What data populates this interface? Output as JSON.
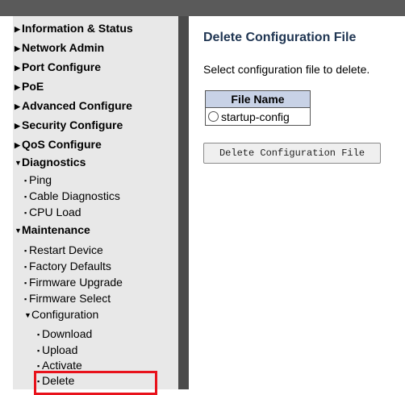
{
  "sidebar": {
    "top_items": [
      {
        "label": "Information & Status",
        "caret": "▶"
      },
      {
        "label": "Network Admin",
        "caret": "▶"
      },
      {
        "label": "Port Configure",
        "caret": "▶"
      },
      {
        "label": "PoE",
        "caret": "▶"
      },
      {
        "label": "Advanced Configure",
        "caret": "▶"
      },
      {
        "label": "Security Configure",
        "caret": "▶"
      },
      {
        "label": "QoS Configure",
        "caret": "▶"
      },
      {
        "label": "Diagnostics",
        "caret": "▼"
      },
      {
        "label": "Maintenance",
        "caret": "▼"
      }
    ],
    "diagnostics_items": [
      "Ping",
      "Cable Diagnostics",
      "CPU Load"
    ],
    "maintenance_items": [
      "Restart Device",
      "Factory Defaults",
      "Firmware Upgrade",
      "Firmware Select"
    ],
    "configuration": {
      "label": "Configuration",
      "caret": "▼",
      "items": [
        "Download",
        "Upload",
        "Activate",
        "Delete"
      ]
    },
    "bullet": "▪",
    "highlight_color": "#e8121b"
  },
  "main": {
    "title": "Delete Configuration File",
    "instructions": "Select configuration file to delete.",
    "table": {
      "header": "File Name",
      "rows": [
        {
          "name": "startup-config",
          "selected": false
        }
      ]
    },
    "delete_button": "Delete Configuration File"
  },
  "colors": {
    "topbar": "#5a5a5a",
    "sidebar_bg": "#e8e8e8",
    "divider": "#4a4a4a",
    "title": "#1f3552",
    "table_header_bg": "#c8d2e6"
  }
}
